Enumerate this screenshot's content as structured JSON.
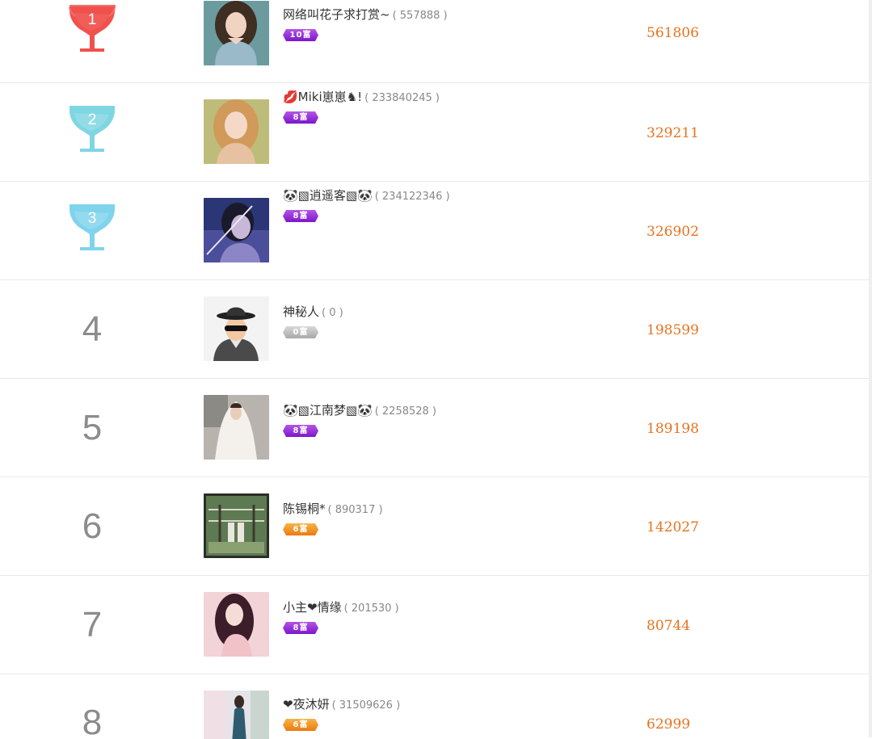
{
  "colors": {
    "gold": "#f0514c",
    "silver": "#7fd6e3",
    "bronze": "#7fd3ec",
    "score": "#e8731f",
    "rank_text": "#8c8c8c",
    "badge_purple": "#9b35d8",
    "badge_gray": "#b5b5b5",
    "badge_orange": "#f0921e"
  },
  "leaderboard": {
    "rows": [
      {
        "rank": "1",
        "rank_style": "trophy-red",
        "nickname": "网络叫花子求打赏~",
        "user_id": "( 557888 )",
        "wealth_badge": "10富",
        "badge_color": "purple",
        "score": "561806",
        "avatar": "woman-portrait-avatar"
      },
      {
        "rank": "2",
        "rank_style": "trophy-teal",
        "nickname": "💋Miki崽崽♞!",
        "user_id": "( 233840245 )",
        "wealth_badge": "8富",
        "badge_color": "purple",
        "score": "329211",
        "avatar": "blonde-woman-avatar"
      },
      {
        "rank": "3",
        "rank_style": "trophy-blue",
        "nickname": "🐼▧逍遥客▧🐼",
        "user_id": "( 234122346 )",
        "wealth_badge": "8富",
        "badge_color": "purple",
        "score": "326902",
        "avatar": "swordsman-avatar"
      },
      {
        "rank": "4",
        "rank_style": "number",
        "nickname": "神秘人",
        "user_id": "( 0 )",
        "wealth_badge": "0富",
        "badge_color": "gray",
        "score": "198599",
        "avatar": "mystery-man-avatar"
      },
      {
        "rank": "5",
        "rank_style": "number",
        "nickname": "🐼▧江南梦▧🐼",
        "user_id": "( 2258528 )",
        "wealth_badge": "8富",
        "badge_color": "purple",
        "score": "189198",
        "avatar": "bride-avatar"
      },
      {
        "rank": "6",
        "rank_style": "number",
        "nickname": "陈锡桐*",
        "user_id": "( 890317 )",
        "wealth_badge": "6富",
        "badge_color": "orange",
        "score": "142027",
        "avatar": "couple-bridge-avatar"
      },
      {
        "rank": "7",
        "rank_style": "number",
        "nickname": "小主❤情缘",
        "user_id": "( 201530 )",
        "wealth_badge": "8富",
        "badge_color": "purple",
        "score": "80744",
        "avatar": "woman-pink-avatar"
      },
      {
        "rank": "8",
        "rank_style": "number",
        "nickname": "❤夜沐妍",
        "user_id": "( 31509626 )",
        "wealth_badge": "6富",
        "badge_color": "orange",
        "score": "62999",
        "avatar": "woman-outdoor-avatar"
      }
    ]
  }
}
